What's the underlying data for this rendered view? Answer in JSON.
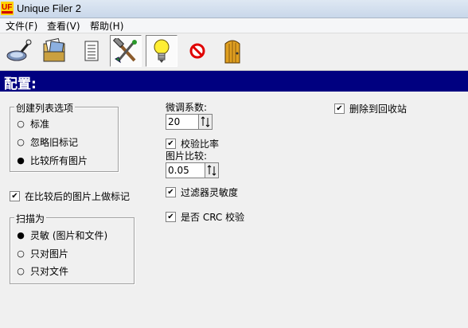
{
  "window": {
    "title": "Unique Filer 2",
    "icon_text": "UF"
  },
  "menu": [
    "文件(F)",
    "查看(V)",
    "帮助(H)"
  ],
  "toolbar_icons": [
    "magnifier-icon",
    "folder-photos-icon",
    "list-icon",
    "tools-icon",
    "lightbulb-icon",
    "stop-icon",
    "door-icon"
  ],
  "section_header": "配置:",
  "list_options": {
    "title": "创建列表选项",
    "options": [
      "标准",
      "忽略旧标记",
      "比较所有图片"
    ],
    "selected": 2
  },
  "mark_after_compare": {
    "label": "在比较后的图片上做标记",
    "checked": true
  },
  "scan": {
    "title": "扫描为",
    "options": [
      "灵敏 (图片和文件)",
      "只对图片",
      "只对文件"
    ],
    "selected": 0
  },
  "fine_tune": {
    "label": "微调系数:",
    "value": "20"
  },
  "verify_ratio": {
    "label": "校验比率",
    "checked": true
  },
  "image_compare": {
    "label": "图片比较:",
    "value": "0.05"
  },
  "filter_sensitivity": {
    "label": "过滤器灵敏度",
    "checked": true
  },
  "crc_check": {
    "label": "是否 CRC 校验",
    "checked": true
  },
  "delete_to_recycle": {
    "label": "删除到回收站",
    "checked": true
  },
  "colors": {
    "header_bg": "#000080",
    "header_text": "#ffffff"
  }
}
